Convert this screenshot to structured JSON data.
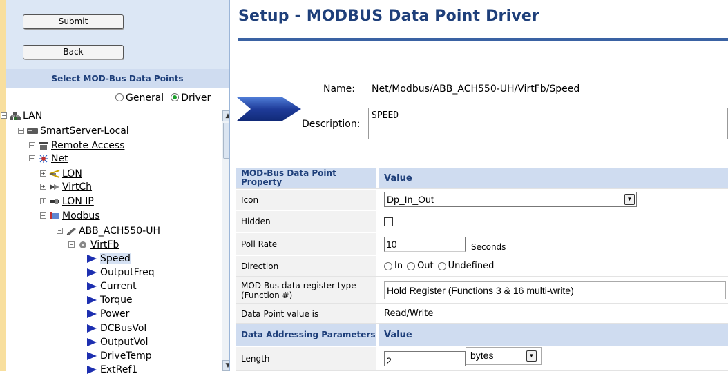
{
  "header": {
    "title": "Setup - MODBUS Data Point Driver"
  },
  "buttons": {
    "submit": "Submit",
    "back": "Back"
  },
  "left_panel": {
    "heading": "Select MOD-Bus Data Points",
    "radio_general": "General",
    "radio_driver": "Driver",
    "radio_selected": "Driver",
    "tree": {
      "lan": "LAN",
      "smartserver": "SmartServer-Local",
      "remote_access": "Remote Access",
      "net": "Net",
      "lon": "LON",
      "virtch": "VirtCh",
      "lon_ip": "LON IP",
      "modbus": "Modbus",
      "device": "ABB_ACH550-UH",
      "virtfb": "VirtFb",
      "points": [
        "Speed",
        "OutputFreq",
        "Current",
        "Torque",
        "Power",
        "DCBusVol",
        "OutputVol",
        "DriveTemp",
        "ExtRef1"
      ],
      "selected_point": "Speed"
    }
  },
  "detail": {
    "name_label": "Name:",
    "name_value": "Net/Modbus/ABB_ACH550-UH/VirtFb/Speed",
    "description_label": "Description:",
    "description_value": "SPEED"
  },
  "grid": {
    "section1_col1": "MOD-Bus Data Point Property",
    "section1_col2": "Value",
    "icon_label": "Icon",
    "icon_value": "Dp_In_Out",
    "hidden_label": "Hidden",
    "hidden_checked": false,
    "poll_label": "Poll Rate",
    "poll_value": "10",
    "poll_unit": "Seconds",
    "direction_label": "Direction",
    "direction_options": [
      "In",
      "Out",
      "Undefined"
    ],
    "register_label": "MOD-Bus data register type (Function #)",
    "register_value": "Hold Register (Functions 3 & 16 multi-write)",
    "access_label": "Data Point value is",
    "access_value": "Read/Write",
    "section2_col1": "Data Addressing Parameters",
    "section2_col2": "Value",
    "length_label": "Length",
    "length_value": "2",
    "length_unit": "bytes"
  },
  "colors": {
    "title": "#1e3f7a",
    "header_band": "#cfdcf0",
    "point_icon": "#1d2fb0",
    "tree_stripe": "#f8df9e"
  }
}
